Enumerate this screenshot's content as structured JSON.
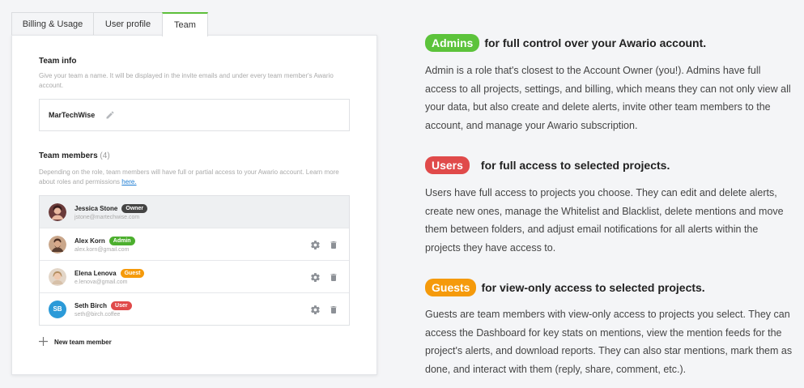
{
  "tabs": [
    {
      "label": "Billing & Usage"
    },
    {
      "label": "User profile"
    },
    {
      "label": "Team"
    }
  ],
  "team_info": {
    "title": "Team info",
    "hint": "Give your team a name. It will be displayed in the invite emails and under every team member's Awario account.",
    "name_value": "MarTechWise"
  },
  "team_members": {
    "title": "Team members",
    "count": "(4)",
    "hint_text": "Depending on the role, team members will have full or partial access to your Awario account. Learn more about roles and permissions",
    "hint_link": "here.",
    "members": [
      {
        "name": "Jessica Stone",
        "role": "Owner",
        "email": "jstone@martechwise.com",
        "initials": "",
        "role_color": "#444444"
      },
      {
        "name": "Alex Korn",
        "role": "Admin",
        "email": "alex.korn@gmail.com",
        "initials": "",
        "role_color": "#4caf2e"
      },
      {
        "name": "Elena Lenova",
        "role": "Guest",
        "email": "e.lenova@gmail.com",
        "initials": "",
        "role_color": "#f59a0b"
      },
      {
        "name": "Seth Birch",
        "role": "User",
        "email": "seth@birch.coffee",
        "initials": "SB",
        "role_color": "#e04a4a"
      }
    ],
    "add_label": "New team member"
  },
  "roles": {
    "admins": {
      "pill": "Admins",
      "tagline": "for full control over your Awario account.",
      "description": "Admin is a role that's closest to the Account Owner (you!). Admins have full access to all projects, settings, and billing, which means they can not only view all your data, but also create and delete alerts, invite other team members to the account, and manage your Awario subscription.",
      "color": "#5cc33b"
    },
    "users": {
      "pill": "Users",
      "tagline": "for full access to selected projects.",
      "description": "Users have full access to projects you choose. They can edit and delete alerts, create new ones, manage the Whitelist and Blacklist, delete mentions and move them between folders, and adjust email notifications for all alerts within the projects they have access to.",
      "color": "#e04a4a"
    },
    "guests": {
      "pill": "Guests",
      "tagline": "for view-only access to selected projects.",
      "description": "Guests are team members with view-only access to projects you select. They can access the Dashboard for key stats on mentions, view the mention feeds for the project's alerts, and download reports. They can also star mentions, mark them as done, and interact with them (reply, share, comment, etc.).",
      "color": "#f59a0b"
    }
  }
}
